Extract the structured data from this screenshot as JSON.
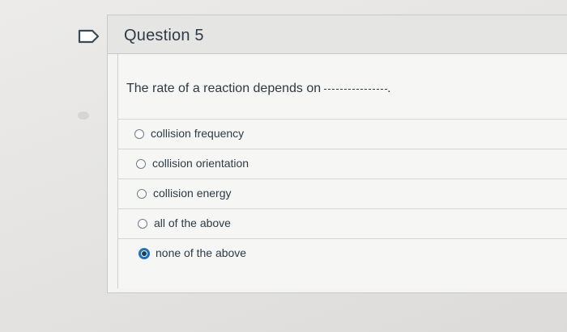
{
  "question": {
    "title": "Question 5",
    "prompt": "The rate of a reaction depends on",
    "prompt_end": ".",
    "flag_icon": "flag-question-icon"
  },
  "answers": [
    {
      "label": "collision frequency",
      "selected": false
    },
    {
      "label": "collision orientation",
      "selected": false
    },
    {
      "label": "collision energy",
      "selected": false
    },
    {
      "label": "all of the above",
      "selected": false
    },
    {
      "label": "none of the above",
      "selected": true
    }
  ],
  "colors": {
    "accent": "#1e72c6",
    "text": "#2d3b45"
  }
}
